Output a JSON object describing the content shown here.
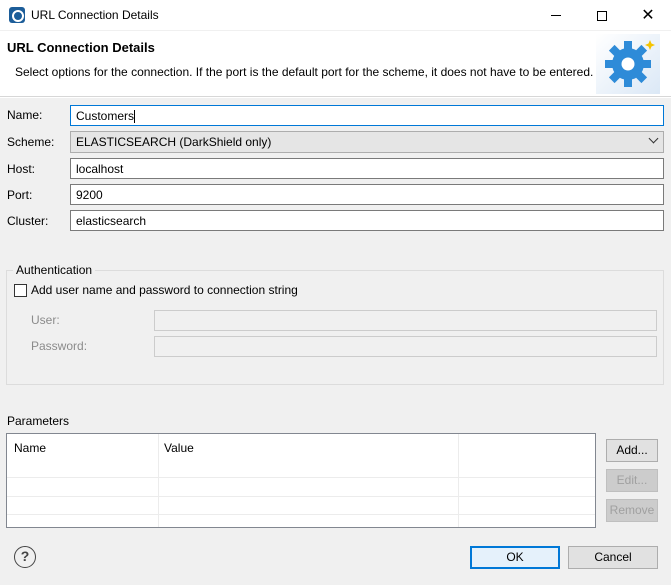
{
  "window": {
    "title": "URL Connection Details",
    "close_glyph": "✕"
  },
  "banner": {
    "title": "URL Connection Details",
    "description": "Select options for the connection. If the port is the default port for the scheme, it does not have to be entered.",
    "icon": "gear-icon"
  },
  "form": {
    "name": {
      "label": "Name:",
      "value": "Customers"
    },
    "scheme": {
      "label": "Scheme:",
      "value": "ELASTICSEARCH (DarkShield only)"
    },
    "host": {
      "label": "Host:",
      "value": "localhost"
    },
    "port": {
      "label": "Port:",
      "value": "9200"
    },
    "cluster": {
      "label": "Cluster:",
      "value": "elasticsearch"
    }
  },
  "authentication": {
    "legend": "Authentication",
    "checkbox_label": "Add user name and password to connection string",
    "checked": false,
    "user_label": "User:",
    "password_label": "Password:"
  },
  "parameters": {
    "label": "Parameters",
    "columns": [
      "Name",
      "Value"
    ],
    "rows": [],
    "buttons": {
      "add": "Add...",
      "edit": "Edit...",
      "remove": "Remove"
    }
  },
  "footer": {
    "help_glyph": "?",
    "ok": "OK",
    "cancel": "Cancel"
  },
  "colors": {
    "accent": "#0078d7",
    "gear": "#2e8bd8",
    "background": "#f0f0f0"
  }
}
